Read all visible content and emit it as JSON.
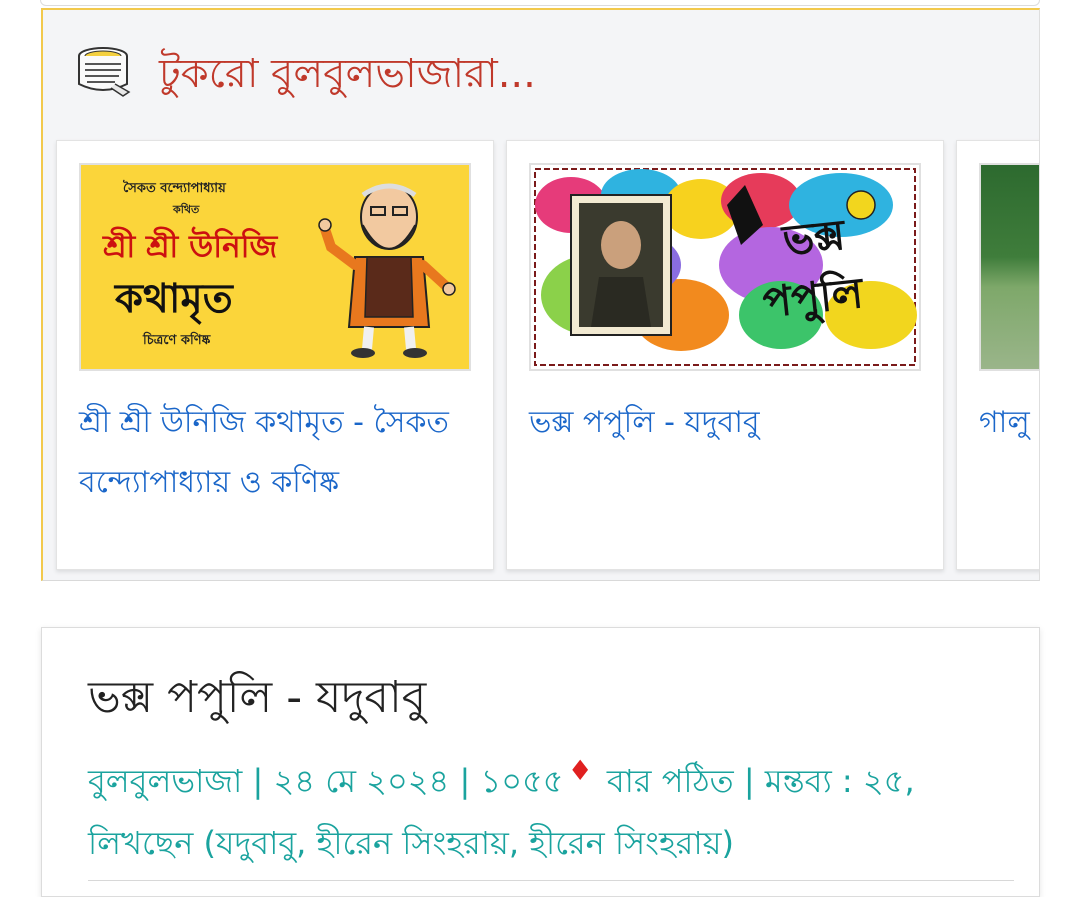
{
  "section": {
    "title": "টুকরো বুলবুলভাজারা...",
    "icon": "newspaper-icon"
  },
  "cards": [
    {
      "title": "শ্রী শ্রী উনিজি কথামৃত - সৈকত বন্দ্যোপাধ্যায় ও কণিষ্ক",
      "thumb": {
        "author_line": "সৈকত বন্দ্যোপাধ্যায়",
        "said_line": "কথিত",
        "red_line": "শ্রী শ্রী উনিজি",
        "big_line": "কথামৃত",
        "credit_line": "চিত্রণে কণিষ্ক",
        "bg_color": "#fbd53a"
      }
    },
    {
      "title": "ভক্স পপুলি - যদুবাবু",
      "thumb": {
        "line1": "ভক্স",
        "line2": "পপুলি"
      }
    },
    {
      "title": "গালু"
    }
  ],
  "article": {
    "title": "ভক্স পপুলি - যদুবাবু",
    "category": "বুলবুলভাজা",
    "date": "২৪ মে ২০২৪",
    "reads": "১০৫৫",
    "reads_suffix": "বার পঠিত",
    "comments_label": "মন্তব্য :",
    "comments_count": "২৫",
    "writing_prefix": "লিখছেন",
    "writers": "(যদুবাবু, হীরেন সিংহরায়, হীরেন সিংহরায়)",
    "diamond_color": "#e02020"
  },
  "colors": {
    "title_red": "#c0392b",
    "link_blue": "#1a66c9",
    "meta_teal": "#1aa39e",
    "accent_yellow": "#f2c94c"
  }
}
